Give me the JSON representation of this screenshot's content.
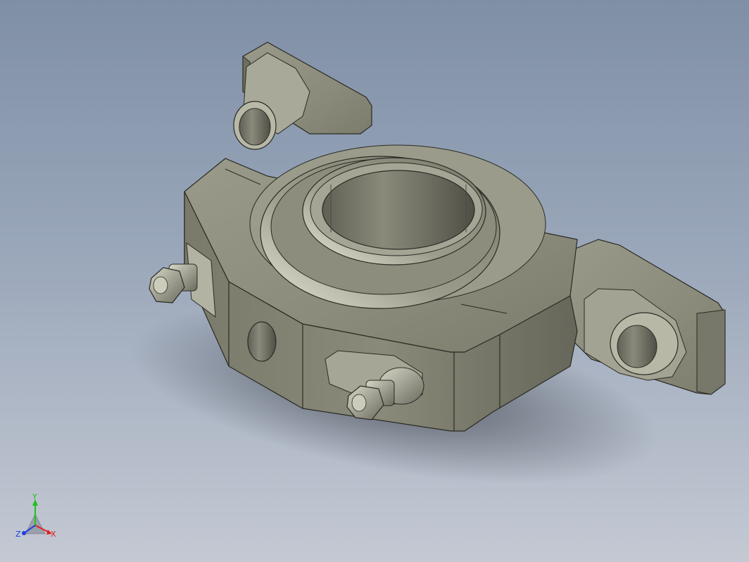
{
  "viewport": {
    "background_top": "#7f8fa6",
    "background_bottom": "#c4c9d3"
  },
  "model": {
    "icon": "pillow-block-bearing-housing-icon",
    "body_color": "#8e8e7f",
    "highlight_color": "#c9c9b8",
    "shadow_color": "#55554b",
    "edge_color": "#2a2a24"
  },
  "triad": {
    "x_label": "X",
    "y_label": "Y",
    "z_label": "Z",
    "x_color": "#e02020",
    "y_color": "#20c020",
    "z_color": "#2040e0"
  }
}
